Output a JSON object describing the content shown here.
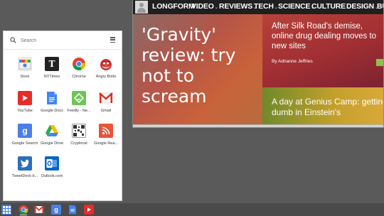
{
  "launcher": {
    "search_placeholder": "Search",
    "apps": [
      {
        "label": "Store",
        "icon": "store-icon"
      },
      {
        "label": "NYTimes",
        "icon": "nytimes-icon"
      },
      {
        "label": "Chrome",
        "icon": "chrome-icon"
      },
      {
        "label": "Angry Birds",
        "icon": "angry-birds-icon"
      },
      {
        "label": "YouTube",
        "icon": "youtube-icon"
      },
      {
        "label": "Google Docs",
        "icon": "google-docs-icon"
      },
      {
        "label": "Feedly - Ne...",
        "icon": "feedly-icon"
      },
      {
        "label": "Gmail",
        "icon": "gmail-icon"
      },
      {
        "label": "Google Search",
        "icon": "google-search-icon"
      },
      {
        "label": "Google Drive",
        "icon": "google-drive-icon"
      },
      {
        "label": "Cryptocat",
        "icon": "cryptocat-icon"
      },
      {
        "label": "Google Rea...",
        "icon": "google-reader-icon"
      },
      {
        "label": "TweetDeck b...",
        "icon": "tweetdeck-icon"
      },
      {
        "label": "Outlook.com",
        "icon": "outlook-icon"
      }
    ]
  },
  "browser": {
    "nav": {
      "items": [
        "LONGFORM",
        "VIDEO",
        "REVIEWS",
        "TECH",
        "SCIENCE",
        "CULTURE",
        "DESIGN",
        "BU"
      ],
      "caret": "⌄"
    },
    "feature_title": "'Gravity' review: try not to scream",
    "story1": {
      "title": "After Silk Road's demise, online drug dealing moves to new sites",
      "byline": "By Adrianne Jeffries"
    },
    "story2": {
      "title": "A day at Genius Camp: getting dumb in Einstein's"
    }
  },
  "shelf": {
    "apps": [
      "chrome-icon",
      "gmail-icon",
      "google-search-icon",
      "google-docs-icon",
      "youtube-icon"
    ]
  },
  "colors": {
    "desktop": "#5a5a5a",
    "navbar": "#1f1f1f",
    "accent_green": "#8bc34a",
    "launcher_blue": "#3b78e7"
  }
}
